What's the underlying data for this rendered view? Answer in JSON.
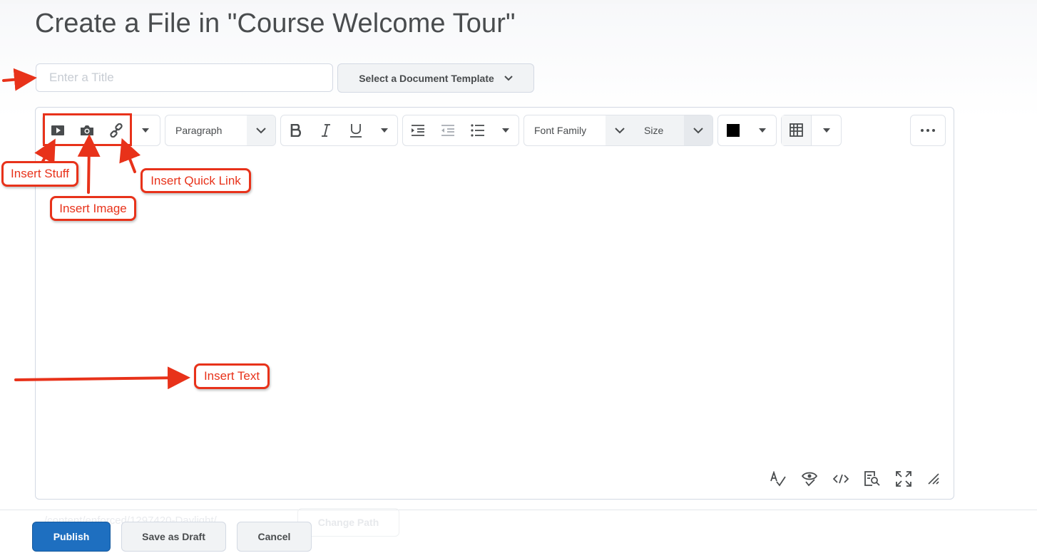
{
  "page": {
    "title": "Create a File in \"Course Welcome Tour\""
  },
  "form": {
    "title_placeholder": "Enter a Title",
    "title_value": "",
    "template_button_label": "Select a Document Template"
  },
  "toolbar": {
    "insert_icons": [
      "insert-stuff-icon",
      "insert-image-icon",
      "insert-quicklink-icon"
    ],
    "format_label": "Paragraph",
    "text_style_icons": [
      "bold-icon",
      "italic-icon",
      "underline-icon"
    ],
    "list_icons": [
      "indent-icon",
      "outdent-icon",
      "bullet-list-icon"
    ],
    "font_family_label": "Font Family",
    "size_label": "Size",
    "color_value": "#000000",
    "more_icon": "more-ellipsis-icon"
  },
  "status_icons": [
    "spellcheck-icon",
    "accessibility-check-icon",
    "source-code-icon",
    "preview-icon",
    "fullscreen-icon",
    "resize-handle-icon"
  ],
  "background_ghost": {
    "path_text": "/content/enforced/1297420-Daylight/",
    "change_path_label": "Change Path"
  },
  "actions": {
    "publish_label": "Publish",
    "save_draft_label": "Save as Draft",
    "cancel_label": "Cancel"
  },
  "annotations": {
    "insert_stuff": "Insert Stuff",
    "insert_image": "Insert Image",
    "insert_quicklink": "Insert Quick Link",
    "insert_text": "Insert Text"
  },
  "colors": {
    "primary": "#1e6fc0",
    "annotation_red": "#e8321a",
    "text": "#494c4e"
  }
}
